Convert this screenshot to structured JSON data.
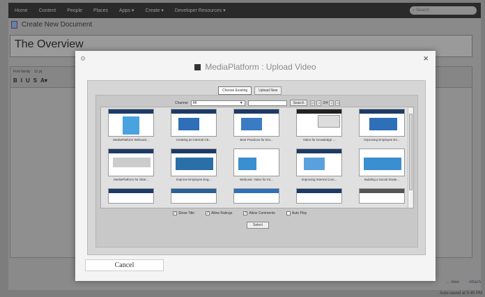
{
  "nav": {
    "items": [
      "Home",
      "Content",
      "People",
      "Places",
      "Apps ▾",
      "Create ▾",
      "Developer Resources ▾"
    ],
    "search_placeholder": "Search"
  },
  "page": {
    "title": "Create New Document",
    "doc_title": "The Overview",
    "toolbar_font": "Font family",
    "toolbar_size": "12 pt",
    "format_buttons": [
      "B",
      "I",
      "U",
      "S",
      "A▾"
    ],
    "bottom_links": [
      "... view",
      "Attach"
    ],
    "autosaved": "Auto-saved at 5:45 PM"
  },
  "modal": {
    "title": "MediaPlatform : Upload Video",
    "tabs": [
      "Choose Existing",
      "Upload New"
    ],
    "channel_label": "Channel",
    "channel_value": "All",
    "search_button": "Search",
    "pager": [
      "|<",
      "<",
      "2/4",
      ">",
      ">|"
    ],
    "videos": [
      "MediaPlatform Webcast...",
      "Creating an Internal CE...",
      "Best Practices for Ent...",
      "Video for Knowledge ...",
      "Improving Employee En...",
      "MediaPlatform for Shar...",
      "Improve Employee Eng...",
      "Webcast: Video for Int...",
      "Improving Internal Com...",
      "Building a Social Strate...",
      "",
      "",
      "",
      "",
      ""
    ],
    "options": [
      {
        "label": "Show Title",
        "checked": true
      },
      {
        "label": "Allow Ratings",
        "checked": true
      },
      {
        "label": "Allow Comments",
        "checked": true
      },
      {
        "label": "Auto Play",
        "checked": false
      }
    ],
    "select_button": "Select",
    "cancel_button": "Cancel"
  },
  "colors": {
    "thumb_blue": "#2e6fb8",
    "thumb_dark": "#1b3a66",
    "nav_bg": "#2a2a2a"
  }
}
